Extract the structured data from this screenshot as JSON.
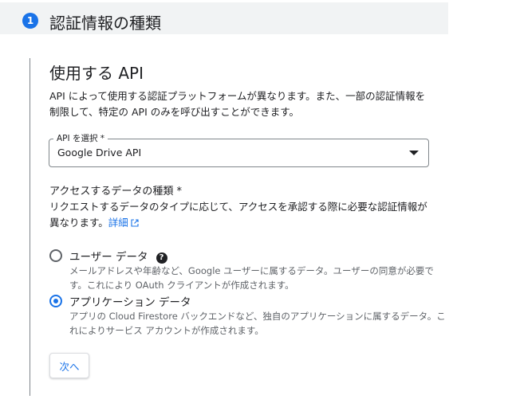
{
  "step": {
    "number": "1",
    "title": "認証情報の種類"
  },
  "section": {
    "title": "使用する API",
    "description": "API によって使用する認証プラットフォームが異なります。また、一部の認証情報を制限して、特定の API のみを呼び出すことができます。"
  },
  "api_select": {
    "label": "API を選択 *",
    "value": "Google Drive API"
  },
  "data_type": {
    "title": "アクセスするデータの種類 *",
    "description": "リクエストするデータのタイプに応じて、アクセスを承認する際に必要な認証情報が異なります。",
    "link_label": "詳細"
  },
  "options": [
    {
      "label": "ユーザー データ",
      "description": "メールアドレスや年齢など、Google ユーザーに属するデータ。ユーザーの同意が必要です。これにより OAuth クライアントが作成されます。",
      "selected": false
    },
    {
      "label": "アプリケーション データ",
      "description": "アプリの Cloud Firestore バックエンドなど、独自のアプリケーションに属するデータ。これによりサービス アカウントが作成されます。",
      "selected": true
    }
  ],
  "next_button": "次へ",
  "colors": {
    "accent": "#1a73e8",
    "header_bg": "#f1f3f4"
  }
}
